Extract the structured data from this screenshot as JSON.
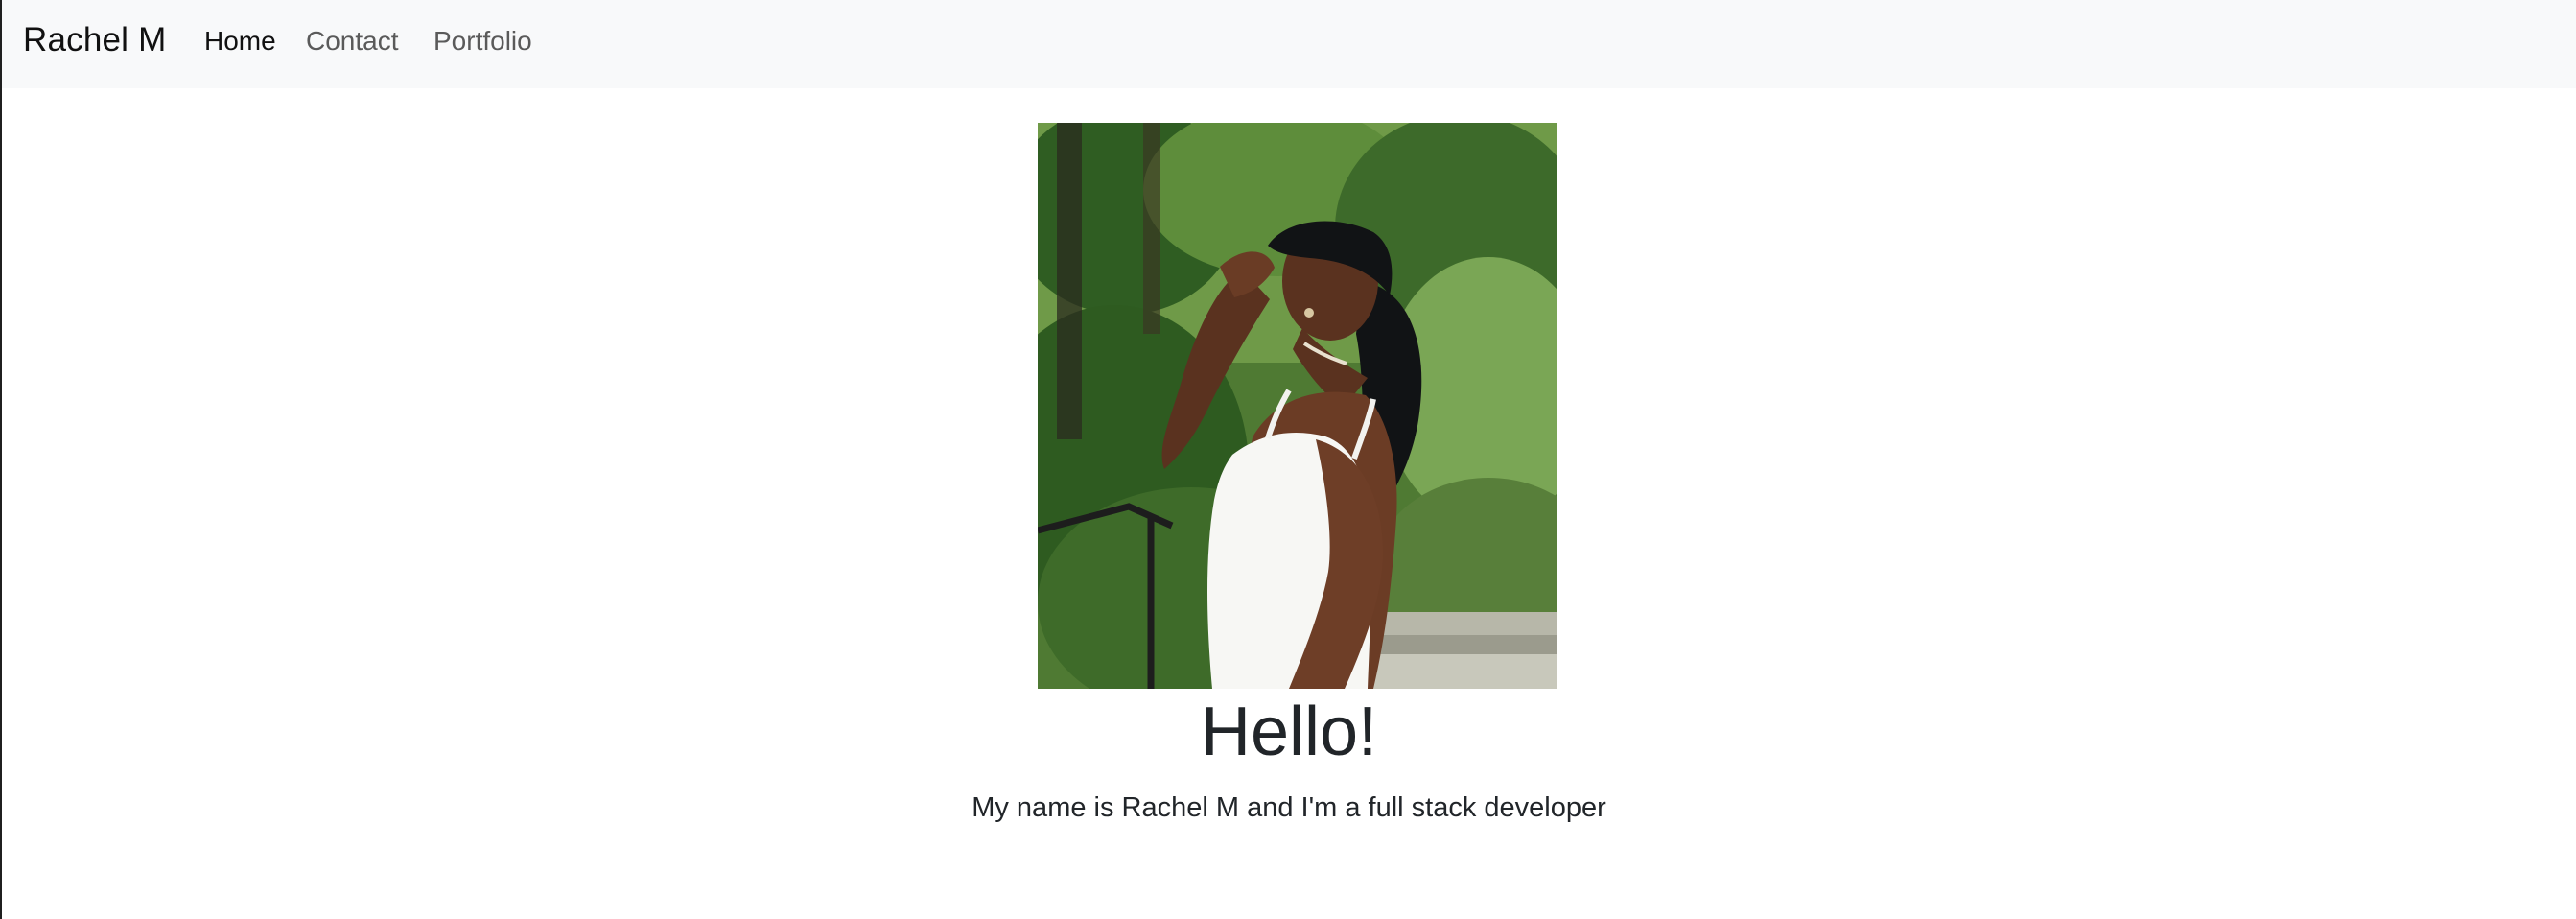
{
  "navbar": {
    "brand": "Rachel M",
    "links": [
      {
        "label": "Home",
        "active": true
      },
      {
        "label": "Contact",
        "active": false
      },
      {
        "label": "Portfolio",
        "active": false
      }
    ]
  },
  "hero": {
    "image": "profile-photo",
    "heading": "Hello!",
    "intro": "My name is Rachel M and I'm a full stack developer"
  },
  "colors": {
    "navbar_bg": "#f8f9fa",
    "text": "#212529",
    "muted_link": "#5a5a5a"
  }
}
